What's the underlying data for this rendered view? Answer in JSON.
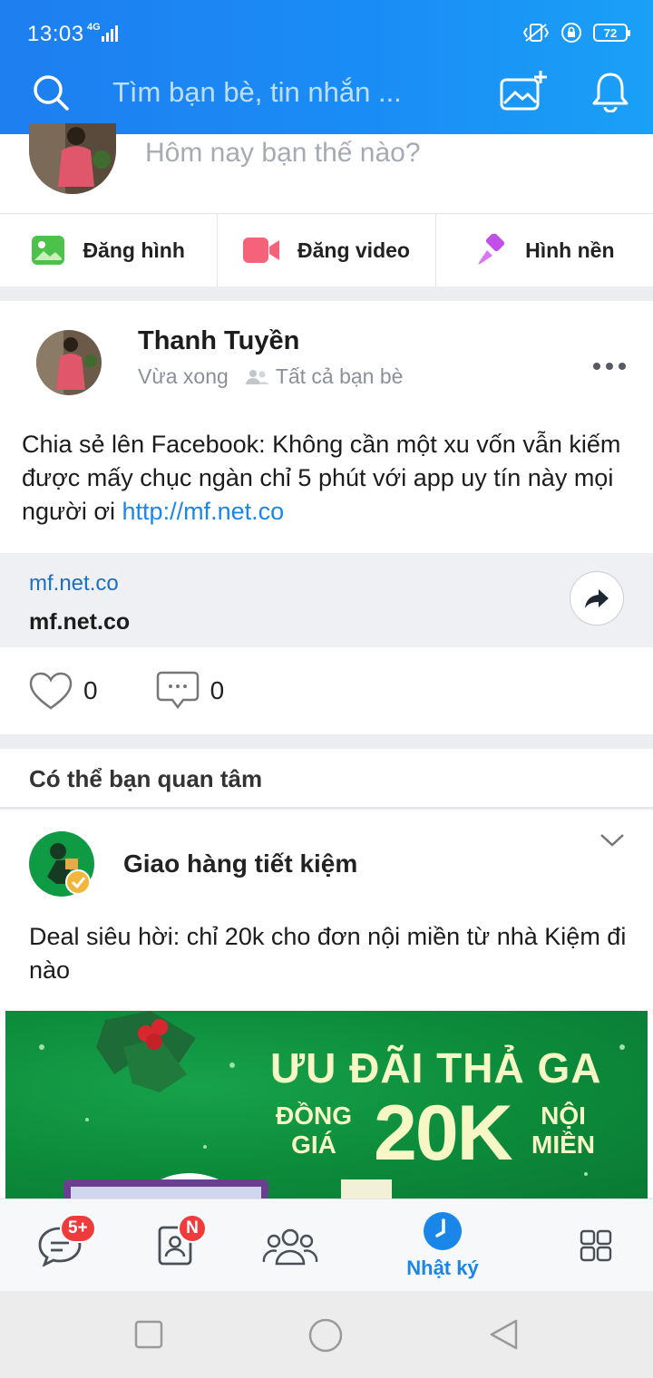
{
  "status_bar": {
    "time": "13:03",
    "network": "4G",
    "battery": "72"
  },
  "header": {
    "search_placeholder": "Tìm bạn bè, tin nhắn ...",
    "icons": [
      "search-icon",
      "photo-add-icon",
      "bell-icon"
    ],
    "colors": {
      "bar_start": "#1e7ff0",
      "bar_end": "#1aa0f7"
    }
  },
  "composer": {
    "prompt": "Hôm nay bạn thế nào?",
    "actions": [
      {
        "label": "Đăng hình",
        "icon": "image-icon",
        "color": "#4cc24a"
      },
      {
        "label": "Đăng video",
        "icon": "video-icon",
        "color": "#f5637a"
      },
      {
        "label": "Hình nền",
        "icon": "brush-icon",
        "color": "#c250e8"
      }
    ]
  },
  "post": {
    "author": "Thanh Tuyền",
    "time": "Vừa xong",
    "audience": "Tất cả bạn bè",
    "text": "Chia sẻ lên Facebook: Không cần một xu vốn vẫn kiếm được mấy chục ngàn chỉ 5 phút với app uy tín này mọi người ơi ",
    "link": "http://mf.net.co",
    "preview": {
      "domain": "mf.net.co",
      "title": "mf.net.co"
    },
    "likes": "0",
    "comments": "0"
  },
  "suggestion": {
    "heading": "Có thể bạn quan tâm",
    "name": "Giao hàng tiết kiệm",
    "description": "Deal siêu hời: chỉ 20k cho đơn nội miền từ nhà Kiệm đi nào",
    "banner": {
      "line1": "ƯU ĐÃI THẢ GA",
      "left": "ĐỒNG\nGIÁ",
      "big": "20K",
      "right": "NỘI\nMIỀN"
    }
  },
  "bottom_nav": {
    "messages_badge": "5+",
    "contacts_badge": "N",
    "active_label": "Nhật ký",
    "accent": "#1a86e8"
  }
}
